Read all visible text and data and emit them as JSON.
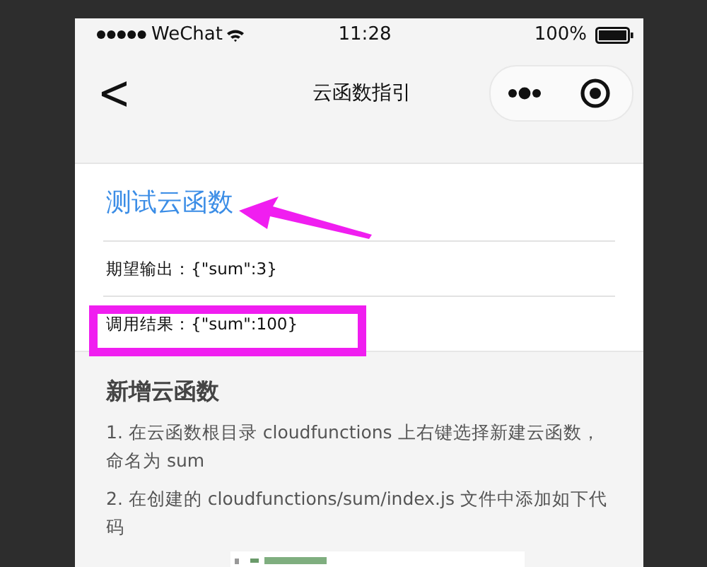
{
  "status_bar": {
    "carrier": "WeChat",
    "time": "11:28",
    "battery": "100%"
  },
  "nav_bar": {
    "back": "<",
    "title": "云函数指引"
  },
  "test_section": {
    "title": "测试云函数",
    "rows": [
      {
        "text": "期望输出：{\"sum\":3}"
      },
      {
        "text": "调用结果：{\"sum\":100}"
      }
    ]
  },
  "guide_section": {
    "heading": "新增云函数",
    "steps": [
      "1. 在云函数根目录 cloudfunctions 上右键选择新建云函数，命名为 sum",
      "2. 在创建的 cloudfunctions/sum/index.js 文件中添加如下代码"
    ]
  }
}
